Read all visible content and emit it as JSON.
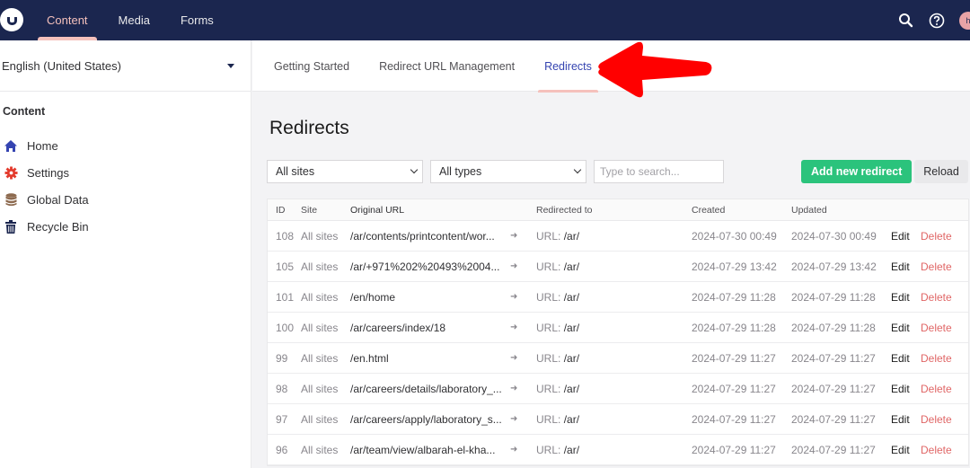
{
  "header": {
    "nav": [
      {
        "label": "Content",
        "active": true
      },
      {
        "label": "Media",
        "active": false
      },
      {
        "label": "Forms",
        "active": false
      }
    ],
    "icons": [
      "search-icon",
      "help-icon",
      "user-avatar"
    ],
    "avatar_initial": "h"
  },
  "sidebar": {
    "culture": "English (United States)",
    "heading": "Content",
    "items": [
      {
        "label": "Home",
        "icon": "home-icon",
        "color": "#3544b1"
      },
      {
        "label": "Settings",
        "icon": "gear-icon",
        "color": "#e33a2c"
      },
      {
        "label": "Global Data",
        "icon": "database-icon",
        "color": "#8d6a4f"
      },
      {
        "label": "Recycle Bin",
        "icon": "trash-icon",
        "color": "#1b264f"
      }
    ]
  },
  "tabs": [
    {
      "label": "Getting Started",
      "active": false
    },
    {
      "label": "Redirect URL Management",
      "active": false
    },
    {
      "label": "Redirects",
      "active": true
    }
  ],
  "main": {
    "title": "Redirects",
    "site_filter": "All sites",
    "type_filter": "All types",
    "search_placeholder": "Type to search...",
    "add_button": "Add new redirect",
    "reload_button": "Reload"
  },
  "table": {
    "columns": [
      "ID",
      "Site",
      "Original URL",
      "Redirected to",
      "Created",
      "Updated"
    ],
    "edit_label": "Edit",
    "delete_label": "Delete",
    "url_prefix": "URL:",
    "rows": [
      {
        "id": "108",
        "site": "All sites",
        "original": "/ar/contents/printcontent/wor...",
        "to": "/ar/",
        "created": "2024-07-30 00:49",
        "updated": "2024-07-30 00:49"
      },
      {
        "id": "105",
        "site": "All sites",
        "original": "/ar/+971%202%20493%2004...",
        "to": "/ar/",
        "created": "2024-07-29 13:42",
        "updated": "2024-07-29 13:42"
      },
      {
        "id": "101",
        "site": "All sites",
        "original": "/en/home",
        "to": "/ar/",
        "created": "2024-07-29 11:28",
        "updated": "2024-07-29 11:28"
      },
      {
        "id": "100",
        "site": "All sites",
        "original": "/ar/careers/index/18",
        "to": "/ar/",
        "created": "2024-07-29 11:28",
        "updated": "2024-07-29 11:28"
      },
      {
        "id": "99",
        "site": "All sites",
        "original": "/en.html",
        "to": "/ar/",
        "created": "2024-07-29 11:27",
        "updated": "2024-07-29 11:27"
      },
      {
        "id": "98",
        "site": "All sites",
        "original": "/ar/careers/details/laboratory_...",
        "to": "/ar/",
        "created": "2024-07-29 11:27",
        "updated": "2024-07-29 11:27"
      },
      {
        "id": "97",
        "site": "All sites",
        "original": "/ar/careers/apply/laboratory_s...",
        "to": "/ar/",
        "created": "2024-07-29 11:27",
        "updated": "2024-07-29 11:27"
      },
      {
        "id": "96",
        "site": "All sites",
        "original": "/ar/team/view/albarah-el-kha...",
        "to": "/ar/",
        "created": "2024-07-29 11:27",
        "updated": "2024-07-29 11:27"
      }
    ]
  },
  "annotation": {
    "type": "red-arrow",
    "points_to": "Redirects tab",
    "color": "#ff0000"
  }
}
